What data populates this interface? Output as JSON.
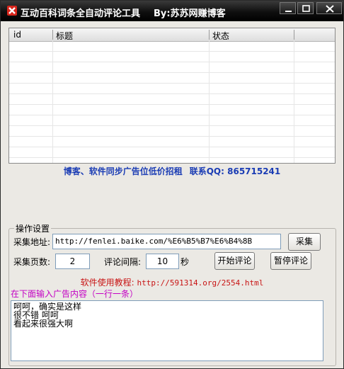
{
  "window": {
    "title": "互动百科词条全自动评论工具",
    "author": "By:苏苏网赚博客",
    "icon": "app-logo-icon",
    "controls": [
      "minimize-icon",
      "maximize-icon",
      "close-icon"
    ]
  },
  "table": {
    "columns": [
      "id",
      "标题",
      "状态"
    ],
    "rows": []
  },
  "ad_banner": {
    "left": "博客、软件同步广告位低价招租",
    "right": "联系QQ: 865715241"
  },
  "settings": {
    "group_label": "操作设置",
    "url_label": "采集地址:",
    "url_value": "http://fenlei.baike.com/%E6%B5%B7%E6%B4%8B",
    "collect_button": "采集",
    "pages_label": "采集页数:",
    "pages_value": "2",
    "interval_label": "评论间隔:",
    "interval_value": "10",
    "interval_unit": "秒",
    "start_button": "开始评论",
    "pause_button": "暂停评论",
    "tutorial_label": "软件使用教程:",
    "tutorial_url": "http://591314.org/2554.html",
    "ad_hint": "在下面输入广告内容（一行一条）",
    "ad_lines": [
      "呵呵，确实是这样",
      "很不错 呵呵",
      "看起来很强大啊"
    ]
  },
  "colors": {
    "title_bar": "#000000",
    "ad_banner": "#1a3cb4",
    "tutorial": "#c81414",
    "hint": "#c400c4"
  }
}
